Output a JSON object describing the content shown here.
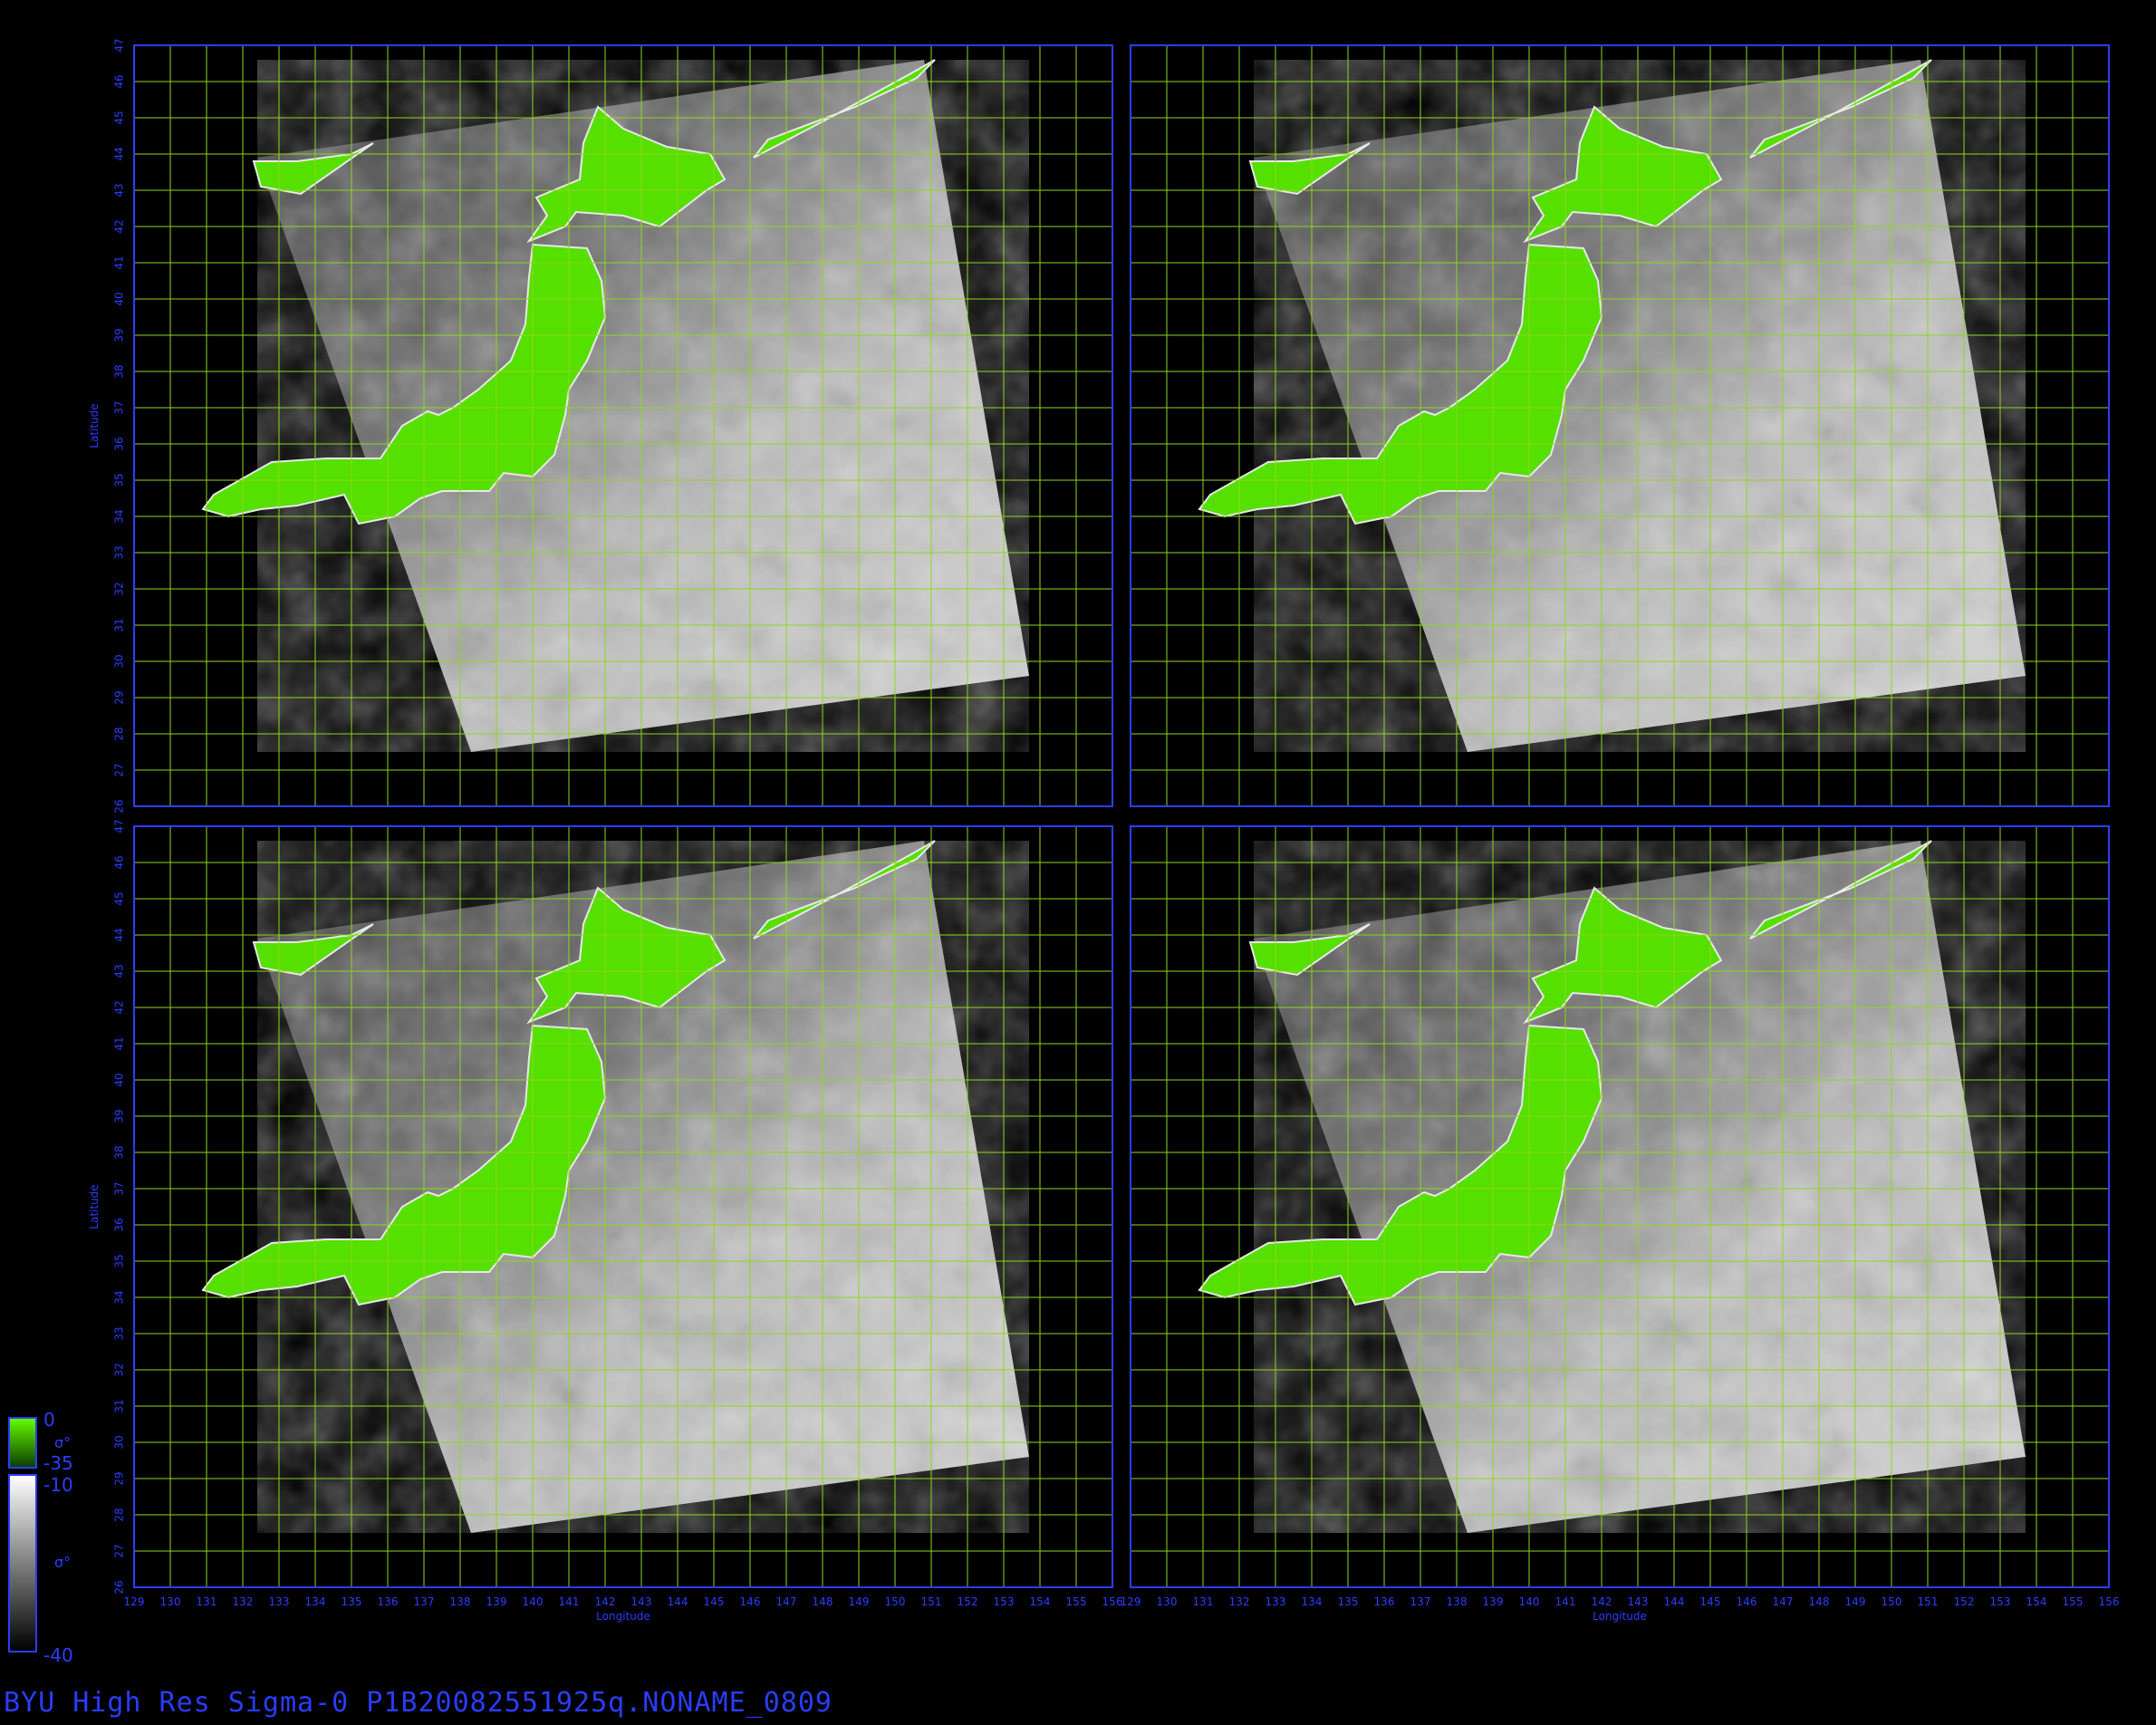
{
  "footer_title": "BYU High Res Sigma-0 P1B20082551925q.NONAME_0809",
  "axes": {
    "x_label": "Longitude",
    "y_label": "Latitude",
    "lon_range": [
      129,
      156
    ],
    "lat_range": [
      26,
      47
    ],
    "lon_ticks": [
      129,
      130,
      131,
      132,
      133,
      134,
      135,
      136,
      137,
      138,
      139,
      140,
      141,
      142,
      143,
      144,
      145,
      146,
      147,
      148,
      149,
      150,
      151,
      152,
      153,
      154,
      155,
      156
    ],
    "lat_ticks": [
      26,
      27,
      28,
      29,
      30,
      31,
      32,
      33,
      34,
      35,
      36,
      37,
      38,
      39,
      40,
      41,
      42,
      43,
      44,
      45,
      46,
      47
    ]
  },
  "panels": [
    {
      "id": "top-left"
    },
    {
      "id": "top-right"
    },
    {
      "id": "bottom-left"
    },
    {
      "id": "bottom-right"
    }
  ],
  "colorbar": {
    "land_top": "0",
    "land_bottom": "-35",
    "land_symbol": "σ°",
    "ocean_top": "-10",
    "ocean_bottom": "-40",
    "ocean_symbol": "σ°"
  },
  "colors": {
    "axis_blue": "#2a3dff",
    "grid_green": "#8fd61e",
    "land_green": "#55e000",
    "background": "#000000"
  }
}
